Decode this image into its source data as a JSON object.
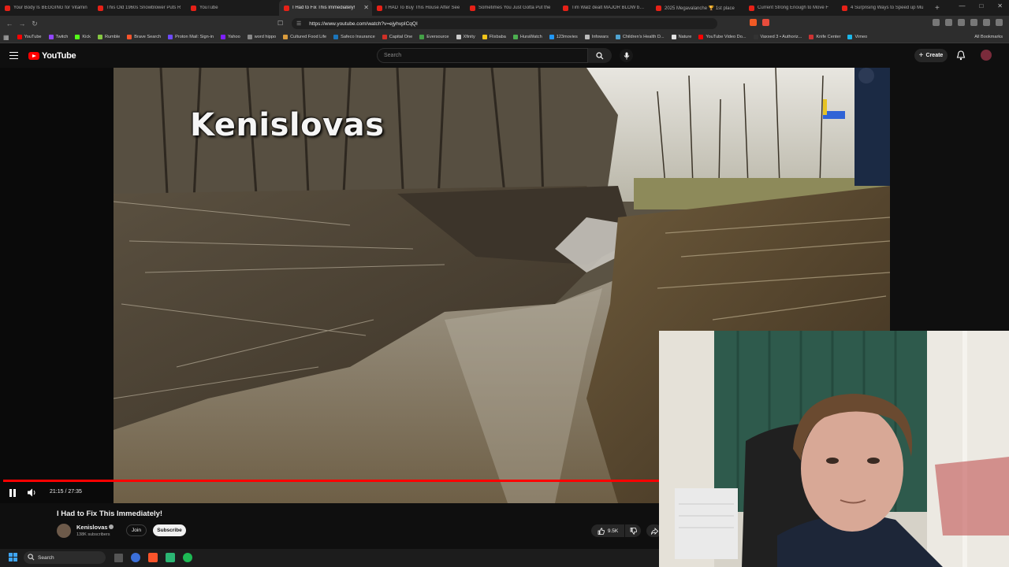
{
  "browser": {
    "tabs": [
      {
        "label": "Your Body Is BEGGING for Vitamin",
        "active": false
      },
      {
        "label": "This Old 1960s Snowblower Puts R",
        "active": false
      },
      {
        "label": "YouTube",
        "active": false
      },
      {
        "label": "I Had to Fix This Immediately!",
        "active": true
      },
      {
        "label": "I HAD To Buy This House After See",
        "active": false
      },
      {
        "label": "Sometimes You Just Gotta Put the",
        "active": false
      },
      {
        "label": "Tim Walz dealt MAJOR BLOW by w",
        "active": false
      },
      {
        "label": "2025 Megavalanche 🏆 1st place",
        "active": false
      },
      {
        "label": "Current Strong Enough to Move F",
        "active": false
      },
      {
        "label": "4 Surprising Ways to Speed up Mu",
        "active": false
      }
    ],
    "url": "https://www.youtube.com/watch?v=ejyhvpICqQI",
    "bookmarks": [
      {
        "label": "YouTube",
        "color": "#ff0000"
      },
      {
        "label": "Twitch",
        "color": "#9146ff"
      },
      {
        "label": "Kick",
        "color": "#53fc18"
      },
      {
        "label": "Rumble",
        "color": "#85c742"
      },
      {
        "label": "Brave Search",
        "color": "#fb542b"
      },
      {
        "label": "Proton Mail: Sign-in",
        "color": "#6d4aff"
      },
      {
        "label": "Yahoo",
        "color": "#7e1fff"
      },
      {
        "label": "word hippo",
        "color": "#888888"
      },
      {
        "label": "Cultured Food Life",
        "color": "#d99b3c"
      },
      {
        "label": "Safeco Insurance",
        "color": "#1b75bb"
      },
      {
        "label": "Capital One",
        "color": "#d03027"
      },
      {
        "label": "Eversource",
        "color": "#44a047"
      },
      {
        "label": "Xfinity",
        "color": "#cccccc"
      },
      {
        "label": "Flixbaba",
        "color": "#f0c419"
      },
      {
        "label": "HuraWatch",
        "color": "#4caf50"
      },
      {
        "label": "123movies",
        "color": "#2196f3"
      },
      {
        "label": "Infowars",
        "color": "#bbbbbb"
      },
      {
        "label": "Children's Health D...",
        "color": "#4fa3d1"
      },
      {
        "label": "Nature",
        "color": "#e0e0e0"
      },
      {
        "label": "YouTube Video Do...",
        "color": "#ff0000"
      },
      {
        "label": "Vaxxed 3 • Authoriz...",
        "color": "#333333"
      },
      {
        "label": "Knife Center",
        "color": "#cc3333"
      },
      {
        "label": "Vimeo",
        "color": "#1ab7ea"
      }
    ],
    "all_bookmarks": "All Bookmarks"
  },
  "youtube": {
    "logo": "YouTube",
    "search_placeholder": "Search",
    "create_label": "Create"
  },
  "video": {
    "overlay_text": "Kenislovas",
    "current_time": "21:15",
    "duration": "27:35",
    "time_display": "21:15 / 27:35",
    "progress": 0.7704,
    "title": "I Had to Fix This Immediately!",
    "channel": {
      "name": "Kenislovas",
      "subscribers": "138K subscribers"
    },
    "join_label": "Join",
    "subscribe_label": "Subscribe",
    "likes": "9.5K"
  },
  "taskbar": {
    "search_label": "Search"
  }
}
